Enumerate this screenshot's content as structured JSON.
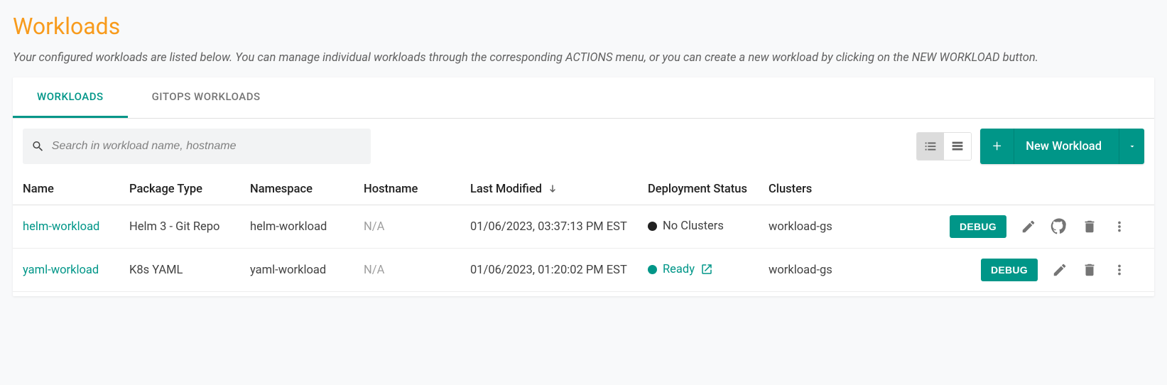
{
  "page": {
    "title": "Workloads",
    "description": "Your configured workloads are listed below. You can manage individual workloads through the corresponding ACTIONS menu, or you can create a new workload by clicking on the NEW WORKLOAD button."
  },
  "tabs": [
    {
      "label": "WORKLOADS",
      "active": true
    },
    {
      "label": "GITOPS WORKLOADS",
      "active": false
    }
  ],
  "toolbar": {
    "search_placeholder": "Search in workload name, hostname",
    "new_workload_label": "New Workload"
  },
  "columns": {
    "name": "Name",
    "package_type": "Package Type",
    "namespace": "Namespace",
    "hostname": "Hostname",
    "last_modified": "Last Modified",
    "deployment_status": "Deployment Status",
    "clusters": "Clusters"
  },
  "rows": [
    {
      "name": "helm-workload",
      "package_type": "Helm 3 - Git Repo",
      "namespace": "helm-workload",
      "hostname": "N/A",
      "last_modified": "01/06/2023, 03:37:13 PM EST",
      "status_text": "No Clusters",
      "status_kind": "none",
      "clusters": "workload-gs",
      "debug_label": "DEBUG",
      "has_github": true
    },
    {
      "name": "yaml-workload",
      "package_type": "K8s YAML",
      "namespace": "yaml-workload",
      "hostname": "N/A",
      "last_modified": "01/06/2023, 01:20:02 PM EST",
      "status_text": "Ready",
      "status_kind": "ready",
      "clusters": "workload-gs",
      "debug_label": "DEBUG",
      "has_github": false
    }
  ]
}
